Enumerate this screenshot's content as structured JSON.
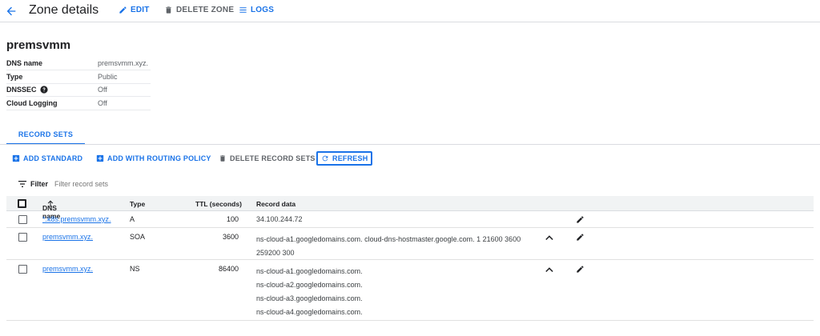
{
  "header": {
    "title": "Zone details",
    "edit_label": "EDIT",
    "delete_label": "DELETE ZONE",
    "logs_label": "LOGS"
  },
  "zone": {
    "name": "premsvmm",
    "details": [
      {
        "key": "DNS name",
        "value": "premsvmm.xyz."
      },
      {
        "key": "Type",
        "value": "Public"
      },
      {
        "key": "DNSSEC",
        "value": "Off"
      },
      {
        "key": "Cloud Logging",
        "value": "Off"
      }
    ]
  },
  "tabs": [
    {
      "label": "RECORD SETS"
    }
  ],
  "actions": {
    "add_standard": "ADD STANDARD",
    "add_routing": "ADD WITH ROUTING POLICY",
    "delete_records": "DELETE RECORD SETS",
    "refresh": "REFRESH"
  },
  "filter": {
    "label": "Filter",
    "placeholder": "Filter record sets"
  },
  "table": {
    "columns": {
      "dns_name": "DNS name",
      "type": "Type",
      "ttl": "TTL (seconds)",
      "record_data": "Record data"
    },
    "rows": [
      {
        "dns_name": "*.k8s.premsvmm.xyz.",
        "type": "A",
        "ttl": "100",
        "record_data": [
          "34.100.244.72"
        ],
        "expandable": false
      },
      {
        "dns_name": "premsvmm.xyz.",
        "type": "SOA",
        "ttl": "3600",
        "record_data": [
          "ns-cloud-a1.googledomains.com. cloud-dns-hostmaster.google.com. 1 21600 3600",
          "259200 300"
        ],
        "expandable": true
      },
      {
        "dns_name": "premsvmm.xyz.",
        "type": "NS",
        "ttl": "86400",
        "record_data": [
          "ns-cloud-a1.googledomains.com.",
          "ns-cloud-a2.googledomains.com.",
          "ns-cloud-a3.googledomains.com.",
          "ns-cloud-a4.googledomains.com."
        ],
        "expandable": true
      }
    ]
  },
  "colors": {
    "accent": "#1a73e8",
    "muted": "#5f6368",
    "header_bg": "#f1f3f4"
  },
  "icons": [
    "arrow-left-icon",
    "pencil-icon",
    "trash-icon",
    "logs-icon",
    "help-icon",
    "plus-box-icon",
    "refresh-icon",
    "filter-icon",
    "arrow-up-icon",
    "chevron-up-icon"
  ]
}
